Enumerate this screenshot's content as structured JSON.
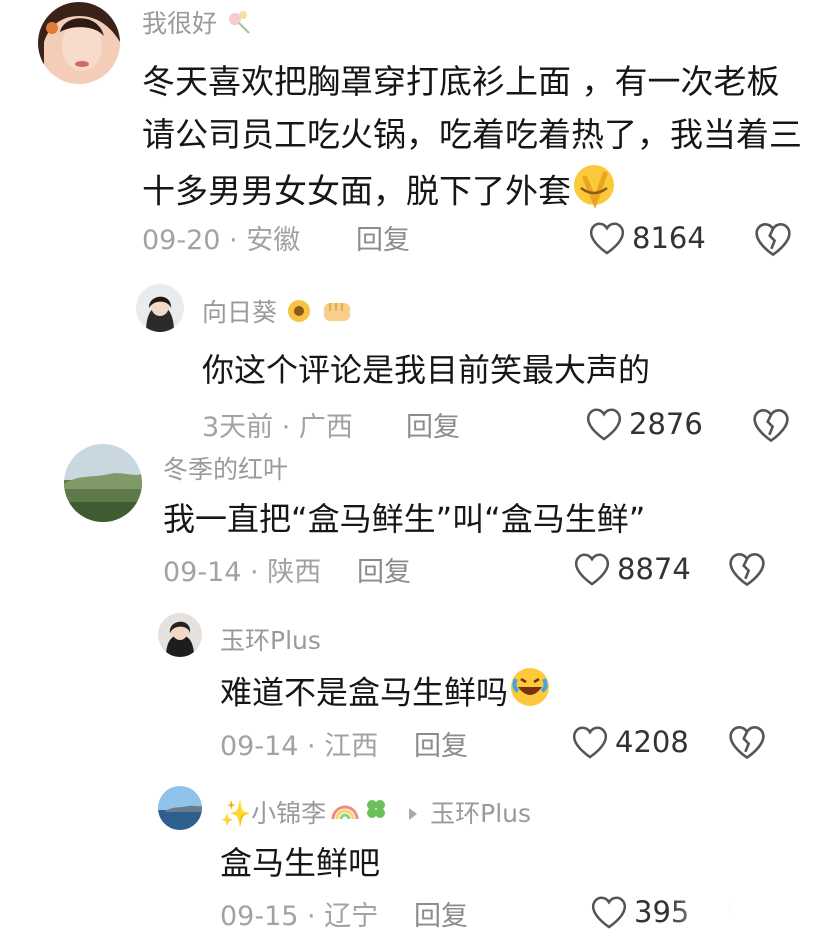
{
  "comments": [
    {
      "username": "我很好",
      "text": "冬天喜欢把胸罩穿打底衫上面 ，有一次老板请公司员工吃火锅，吃着吃着热了，我当着三十多男男女女面，脱下了外套",
      "date_location": "09-20 · 安徽",
      "reply_label": "回复",
      "likes": "8164"
    },
    {
      "username": "向日葵",
      "text": "你这个评论是我目前笑最大声的",
      "date_location": "3天前 · 广西",
      "reply_label": "回复",
      "likes": "2876"
    },
    {
      "username": "冬季的红叶",
      "text": "我一直把“盒马鲜生”叫“盒马生鲜”",
      "date_location": "09-14 · 陕西",
      "reply_label": "回复",
      "likes": "8874"
    },
    {
      "username": "玉环Plus",
      "text": "难道不是盒马生鲜吗",
      "date_location": "09-14 · 江西",
      "reply_label": "回复",
      "likes": "4208"
    },
    {
      "username": "✨小锦李",
      "reply_to": "玉环Plus",
      "text": "盒马生鲜吧",
      "date_location": "09-15 · 辽宁",
      "reply_label": "回复",
      "likes": "395"
    }
  ],
  "icons": {
    "like": "heart-outline-icon",
    "dislike": "broken-heart-icon",
    "reply_arrow": "triangle-right-icon"
  },
  "colors": {
    "username": "#9a9a9a",
    "text": "#161616",
    "meta": "#a2a2a2",
    "icon": "#555555"
  }
}
